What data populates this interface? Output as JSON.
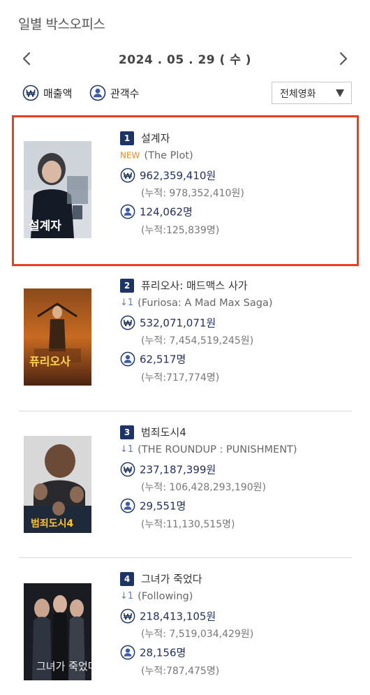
{
  "header": {
    "title": "일별 박스오피스"
  },
  "date_nav": {
    "date": "2024 . 05 . 29 ( 수 )",
    "prev_label": "previous-day",
    "next_label": "next-day"
  },
  "toggles": {
    "sales": "매출액",
    "audience": "관객수"
  },
  "filter": {
    "selected": "전체영화"
  },
  "colors": {
    "accent": "#1d3466",
    "highlight": "#e8401f",
    "new_badge": "#e88b1b"
  },
  "movies": [
    {
      "rank": "1",
      "title": "설계자",
      "change": "NEW",
      "en_title": "(The Plot)",
      "sales": "962,359,410원",
      "sales_cum": "(누적: 978,352,410원)",
      "audience": "124,062명",
      "audience_cum": "(누적:125,839명)",
      "poster_text": "설계자"
    },
    {
      "rank": "2",
      "title": "퓨리오사: 매드맥스 사가",
      "change": "↓1",
      "en_title": "(Furiosa: A Mad Max Saga)",
      "sales": "532,071,071원",
      "sales_cum": "(누적: 7,454,519,245원)",
      "audience": "62,517명",
      "audience_cum": "(누적:717,774명)",
      "poster_text": "퓨리오사"
    },
    {
      "rank": "3",
      "title": "범죄도시4",
      "change": "↓1",
      "en_title": "(THE ROUNDUP : PUNISHMENT)",
      "sales": "237,187,399원",
      "sales_cum": "(누적: 106,428,293,190원)",
      "audience": "29,551명",
      "audience_cum": "(누적:11,130,515명)",
      "poster_text": "범죄도시4"
    },
    {
      "rank": "4",
      "title": "그녀가 죽었다",
      "change": "↓1",
      "en_title": "(Following)",
      "sales": "218,413,105원",
      "sales_cum": "(누적: 7,519,034,429원)",
      "audience": "28,156명",
      "audience_cum": "(누적:787,475명)",
      "poster_text": "그녀가 죽었다"
    }
  ]
}
